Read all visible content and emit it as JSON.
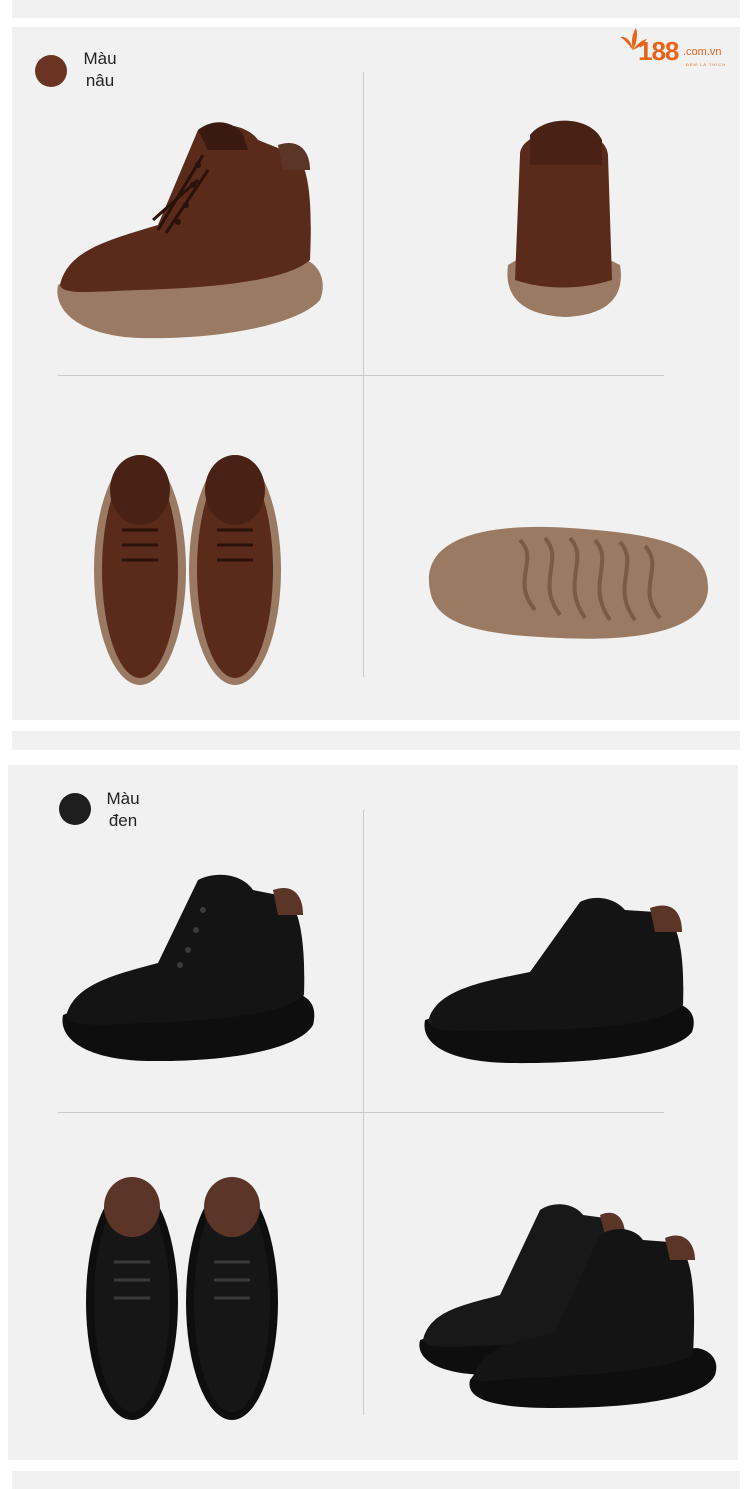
{
  "logo": {
    "number": "188",
    "domain": ".com.vn",
    "tagline": "ĐEM LÀ THÍCH",
    "icon": "leaf-icon",
    "color": "#e8641b"
  },
  "sections": [
    {
      "color_name_line1": "Màu",
      "color_name_line2": "nâu",
      "swatch_color": "#6b3422"
    },
    {
      "color_name_line1": "Màu",
      "color_name_line2": "đen",
      "swatch_color": "#1e1e1e"
    }
  ],
  "colors": {
    "brown_upper": "#5a2a1a",
    "brown_sole": "#9a7a62",
    "black_upper": "#141414",
    "lining": "#5c3529",
    "panel_bg": "#f1f1f1"
  }
}
